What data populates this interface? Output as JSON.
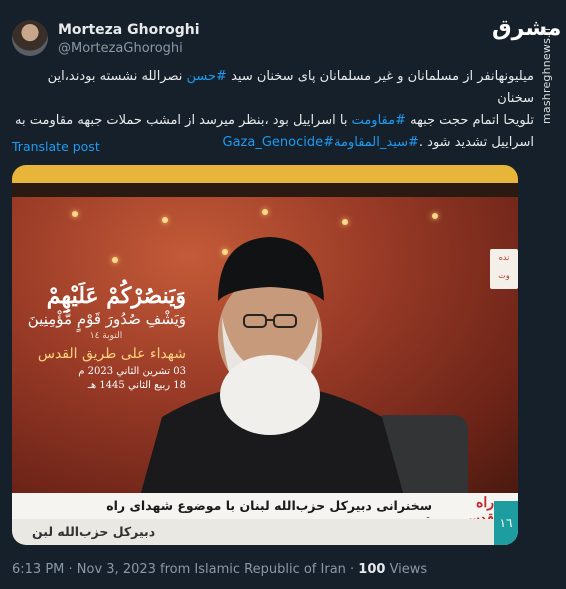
{
  "author": {
    "name": "Morteza Ghoroghi",
    "handle": "@MortezaGhoroghi"
  },
  "watermark": {
    "logo": "مشرق",
    "site": "mashreghnews.ir"
  },
  "tweet": {
    "line1_text": "میلیونهانفر از مسلمانان و غیر مسلمانان پای سخنان سید ",
    "line1_tag": "#حسن",
    "line1_text2": " نصرالله نشسته بودند،این سخنان",
    "line2_text": "تلویحا اتمام حجت جبهه ",
    "line2_tag": "#مقاومت",
    "line2_text2": " با اسراییل بود ،بنظر میرسد از امشب حملات جبهه مقاومت به",
    "line3_text": "اسراییل تشدید شود .",
    "line3_tag1": "#سید_المقاومة",
    "line3_tag2": "#Gaza_Genocide",
    "translate_label": "Translate post"
  },
  "media": {
    "banner_line1": "وَيَنصُرْكُمْ عَلَيْهِمْ",
    "banner_line2": "وَيَشْفِ صُدُورَ قَوْمٍ مُّؤْمِنِينَ",
    "banner_ref": "التوبة ١٤",
    "banner_title": "شهداء على طريق القدس",
    "banner_date1": "03 تشرين الثاني 2023 م",
    "banner_date2": "18 ربيع الثاني 1445 هـ",
    "side_label_top": "نده",
    "side_label_bottom": "وت",
    "caption": "سخنرانی دبیرکل حزب‌الله لبنان با موضوع شهدای راه قدس",
    "caption_logo": "راه قدس",
    "lower_caption": "دبیرکل حزب‌الله لبن",
    "channel_badge": "١٦"
  },
  "meta": {
    "timestamp": "6:13 PM · Nov 3, 2023 from Islamic Republic of Iran · ",
    "views_count": "100",
    "views_label": " Views"
  },
  "colors": {
    "background": "#15202b",
    "link": "#1d9bf0",
    "muted": "#8b98a5"
  }
}
